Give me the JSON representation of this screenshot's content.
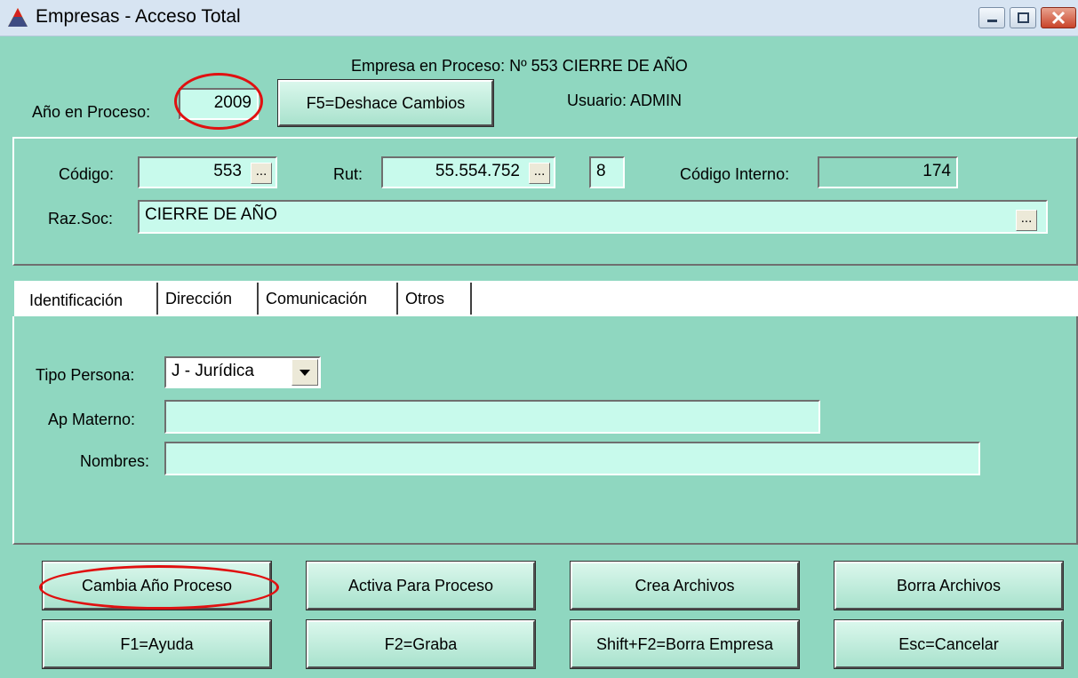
{
  "window": {
    "title": "Empresas - Acceso Total",
    "controls": [
      "minimize-icon",
      "maximize-icon",
      "close-icon"
    ]
  },
  "header": {
    "empresa_en_proceso": "Empresa en Proceso: Nº 553 CIERRE DE AÑO",
    "anio_label": "Año en Proceso:",
    "anio_value": "2009",
    "undo_button": "F5=Deshace Cambios",
    "usuario": "Usuario: ADMIN"
  },
  "company": {
    "codigo_label": "Código:",
    "codigo_value": "553",
    "rut_label": "Rut:",
    "rut_value": "55.554.752",
    "dv_value": "8",
    "codigo_interno_label": "Código Interno:",
    "codigo_interno_value": "174",
    "razsoc_label": "Raz.Soc:",
    "razsoc_value": "CIERRE DE AÑO",
    "lookup_label": "..."
  },
  "tabs": [
    {
      "label": "Identificación",
      "active": true
    },
    {
      "label": "Dirección",
      "active": false
    },
    {
      "label": "Comunicación",
      "active": false
    },
    {
      "label": "Otros",
      "active": false
    }
  ],
  "identificacion": {
    "tipo_persona_label": "Tipo Persona:",
    "tipo_persona_value": "J - Jurídica",
    "ap_materno_label": "Ap Materno:",
    "ap_materno_value": "",
    "nombres_label": "Nombres:",
    "nombres_value": ""
  },
  "buttons": {
    "row1": [
      "Cambia Año Proceso",
      "Activa Para Proceso",
      "Crea Archivos",
      "Borra Archivos"
    ],
    "row2": [
      "F1=Ayuda",
      "F2=Graba",
      "Shift+F2=Borra Empresa",
      "Esc=Cancelar"
    ]
  },
  "colors": {
    "form_background": "#8fd7c0",
    "field_background": "#c8faec",
    "annotation_ring": "#e01010"
  }
}
